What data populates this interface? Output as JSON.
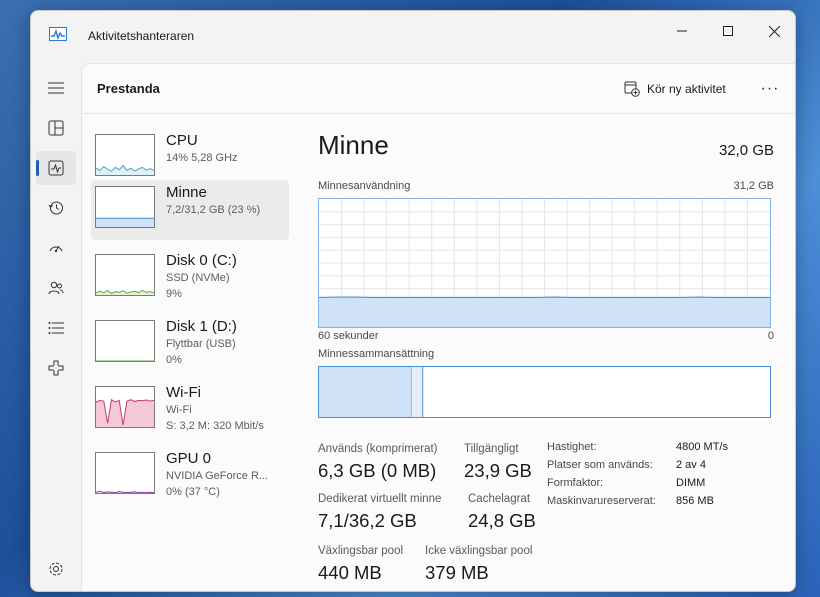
{
  "window": {
    "title": "Aktivitetshanteraren"
  },
  "nav": {
    "items": [
      {
        "name": "hamburger-menu-icon"
      },
      {
        "name": "processes-icon"
      },
      {
        "name": "performance-icon",
        "active": true
      },
      {
        "name": "app-history-icon"
      },
      {
        "name": "startup-apps-icon"
      },
      {
        "name": "users-icon"
      },
      {
        "name": "details-icon"
      },
      {
        "name": "services-icon"
      }
    ],
    "settings_icon": "settings-gear-icon"
  },
  "header": {
    "title": "Prestanda",
    "run_task": "Kör ny aktivitet",
    "more": "···"
  },
  "devices": [
    {
      "name": "CPU",
      "sub1": "14%  5,28 GHz",
      "color": "#4aa3c8",
      "fill": "#dff0f7",
      "values": [
        0.18,
        0.12,
        0.22,
        0.15,
        0.1,
        0.2,
        0.14,
        0.25,
        0.12,
        0.18,
        0.1,
        0.16,
        0.2,
        0.13,
        0.17,
        0.12
      ]
    },
    {
      "name": "Minne",
      "sub1": "7,2/31,2 GB (23 %)",
      "color": "#4a90d9",
      "fill": "#cfe2f8",
      "values": [
        0.23,
        0.23,
        0.23,
        0.23,
        0.23,
        0.23,
        0.23,
        0.23,
        0.23,
        0.23,
        0.23,
        0.23,
        0.23,
        0.23,
        0.23,
        0.23
      ],
      "selected": true
    },
    {
      "name": "Disk 0 (C:)",
      "sub1": "SSD (NVMe)",
      "sub2": "9%",
      "color": "#6aa84f",
      "fill": "#e3f1dc",
      "values": [
        0.05,
        0.1,
        0.06,
        0.12,
        0.04,
        0.09,
        0.07,
        0.11,
        0.05,
        0.08,
        0.1,
        0.06,
        0.12,
        0.07,
        0.09,
        0.06
      ]
    },
    {
      "name": "Disk 1 (D:)",
      "sub1": "Flyttbar (USB)",
      "sub2": "0%",
      "color": "#6aa84f",
      "fill": "#e3f1dc",
      "values": [
        0,
        0,
        0,
        0,
        0,
        0,
        0,
        0,
        0,
        0,
        0,
        0,
        0,
        0,
        0,
        0
      ]
    },
    {
      "name": "Wi-Fi",
      "sub1": "Wi-Fi",
      "sub2": "S: 3,2  M: 320 Mbit/s",
      "color": "#c23b6e",
      "fill": "#f4c9d8",
      "values": [
        0.65,
        0.7,
        0.68,
        0.1,
        0.72,
        0.66,
        0.7,
        0.05,
        0.68,
        0.72,
        0.67,
        0.7,
        0.69,
        0.71,
        0.68,
        0.7
      ]
    },
    {
      "name": "GPU 0",
      "sub1": "NVIDIA GeForce R...",
      "sub2": "0%  (37 °C)",
      "color": "#8e44ad",
      "fill": "#ead9f2",
      "values": [
        0.02,
        0.05,
        0.01,
        0.03,
        0.02,
        0.01,
        0.04,
        0.02,
        0.01,
        0.02,
        0.03,
        0.01,
        0.02,
        0.01,
        0.02,
        0.01
      ]
    }
  ],
  "detail": {
    "title": "Minne",
    "total": "32,0 GB",
    "usage_label": "Minnesanvändning",
    "usage_max": "31,2 GB",
    "axis_left": "60 sekunder",
    "axis_right": "0",
    "composition_label": "Minnessammansättning",
    "stats": {
      "in_use_label": "Används (komprimerat)",
      "in_use_value": "6,3 GB (0 MB)",
      "available_label": "Tillgängligt",
      "available_value": "23,9 GB",
      "committed_label": "Dedikerat virtuellt minne",
      "committed_value": "7,1/36,2 GB",
      "cached_label": "Cachelagrat",
      "cached_value": "24,8 GB",
      "paged_label": "Växlingsbar pool",
      "paged_value": "440 MB",
      "nonpaged_label": "Icke växlingsbar pool",
      "nonpaged_value": "379 MB"
    },
    "properties": [
      {
        "key": "Hastighet:",
        "value": "4800 MT/s"
      },
      {
        "key": "Platser som används:",
        "value": "2 av 4"
      },
      {
        "key": "Formfaktor:",
        "value": "DIMM"
      },
      {
        "key": "Maskinvarureserverat:",
        "value": "856 MB"
      }
    ]
  },
  "chart_data": {
    "type": "area",
    "title": "Minnesanvändning",
    "xlabel": "",
    "ylabel": "",
    "ylim": [
      0,
      31.2
    ],
    "x_range": [
      "60 sekunder",
      "0"
    ],
    "series": [
      {
        "values": [
          7.2,
          7.3,
          7.3,
          7.2,
          7.2,
          7.2,
          7.2,
          7.2,
          7.2,
          7.2,
          7.2,
          7.2,
          7.2,
          7.3,
          7.2,
          7.2,
          7.2,
          7.2,
          7.2,
          7.2,
          7.2,
          7.3,
          7.2,
          7.2,
          7.2,
          7.2
        ]
      }
    ],
    "composition": {
      "in_use_fraction": 0.205,
      "modified_fraction": 0.025
    }
  }
}
